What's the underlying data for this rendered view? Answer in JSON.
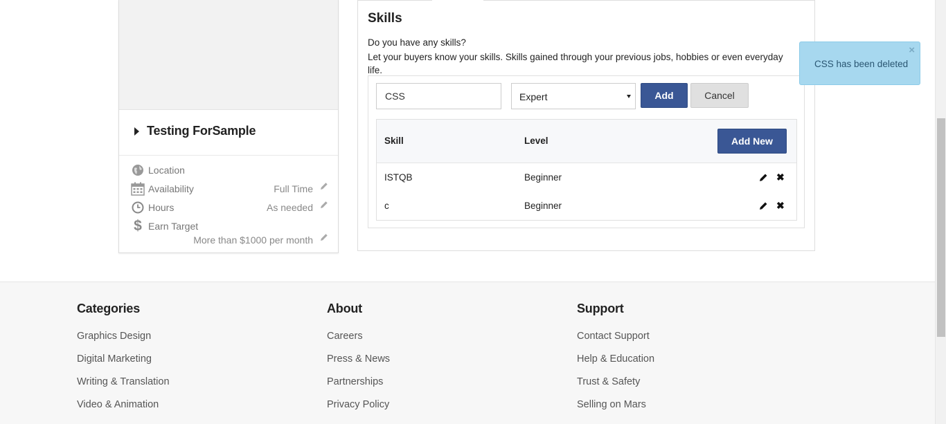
{
  "profile": {
    "name": "Testing ForSample",
    "details": [
      {
        "label": "Location",
        "value": "",
        "icon": "globe-icon",
        "editable": false
      },
      {
        "label": "Availability",
        "value": "Full Time",
        "icon": "calendar-icon",
        "editable": true
      },
      {
        "label": "Hours",
        "value": "As needed",
        "icon": "clock-icon",
        "editable": true
      },
      {
        "label": "Earn Target",
        "value": "More than $1000 per month",
        "icon": "dollar-icon",
        "editable": true
      }
    ]
  },
  "skills": {
    "title": "Skills",
    "question": "Do you have any skills?",
    "description": "Let your buyers know your skills. Skills gained through your previous jobs, hobbies or even everyday life.",
    "form": {
      "skill_value": "CSS",
      "level_value": "Expert",
      "add_label": "Add",
      "cancel_label": "Cancel"
    },
    "table": {
      "headers": {
        "skill": "Skill",
        "level": "Level"
      },
      "add_new_label": "Add New",
      "rows": [
        {
          "skill": "ISTQB",
          "level": "Beginner"
        },
        {
          "skill": "c",
          "level": "Beginner"
        }
      ]
    }
  },
  "toast": {
    "message": "CSS has been deleted",
    "close": "×"
  },
  "footer": {
    "columns": [
      {
        "title": "Categories",
        "links": [
          "Graphics Design",
          "Digital Marketing",
          "Writing & Translation",
          "Video & Animation"
        ]
      },
      {
        "title": "About",
        "links": [
          "Careers",
          "Press & News",
          "Partnerships",
          "Privacy Policy"
        ]
      },
      {
        "title": "Support",
        "links": [
          "Contact Support",
          "Help & Education",
          "Trust & Safety",
          "Selling on Mars"
        ]
      }
    ]
  },
  "colors": {
    "primary_button": "#3a5795",
    "toast_bg": "#a7d8ef"
  }
}
